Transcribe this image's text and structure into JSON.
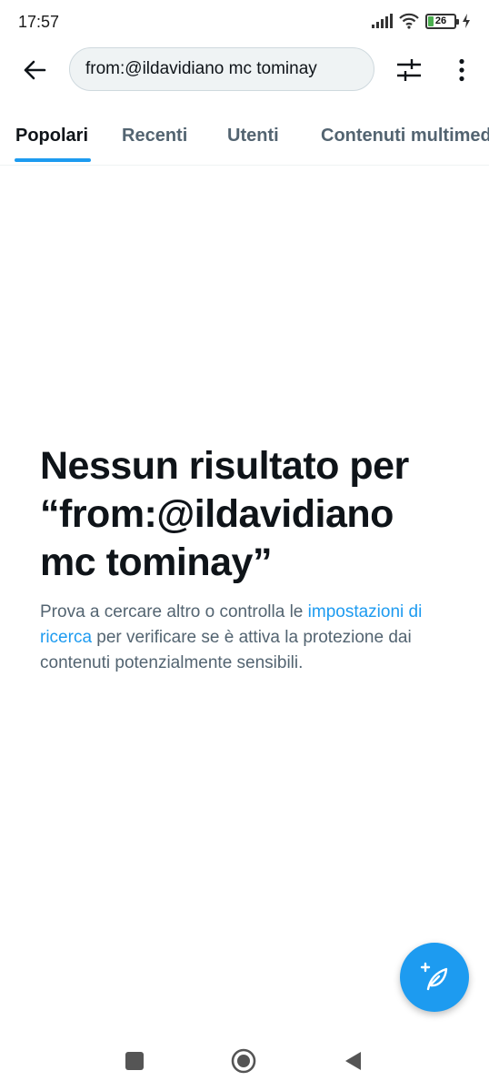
{
  "status_bar": {
    "time": "17:57",
    "battery_level": "26",
    "battery_fraction": 0.26
  },
  "header": {
    "back_icon": "arrow-left-icon",
    "search_value": "from:@ildavidiano mc tominay",
    "filter_icon": "sliders-icon",
    "more_icon": "more-vertical-icon"
  },
  "tabs": [
    {
      "label": "Popolari",
      "active": true
    },
    {
      "label": "Recenti",
      "active": false
    },
    {
      "label": "Utenti",
      "active": false
    },
    {
      "label": "Contenuti multimediali",
      "active": false
    }
  ],
  "empty_state": {
    "title_line1": "Nessun risultato per",
    "title_line2": "“from:@ildavidiano",
    "title_line3": "mc tominay”",
    "body_before": "Prova a cercare altro o controlla le ",
    "body_link": "impostazioni di ricerca",
    "body_after": " per verificare se è attiva la protezione dai contenuti potenzialmente sensibili."
  },
  "fab": {
    "icon": "compose-feather-icon"
  },
  "colors": {
    "accent": "#1d9bf0",
    "text_primary": "#0f1419",
    "text_secondary": "#536471"
  }
}
